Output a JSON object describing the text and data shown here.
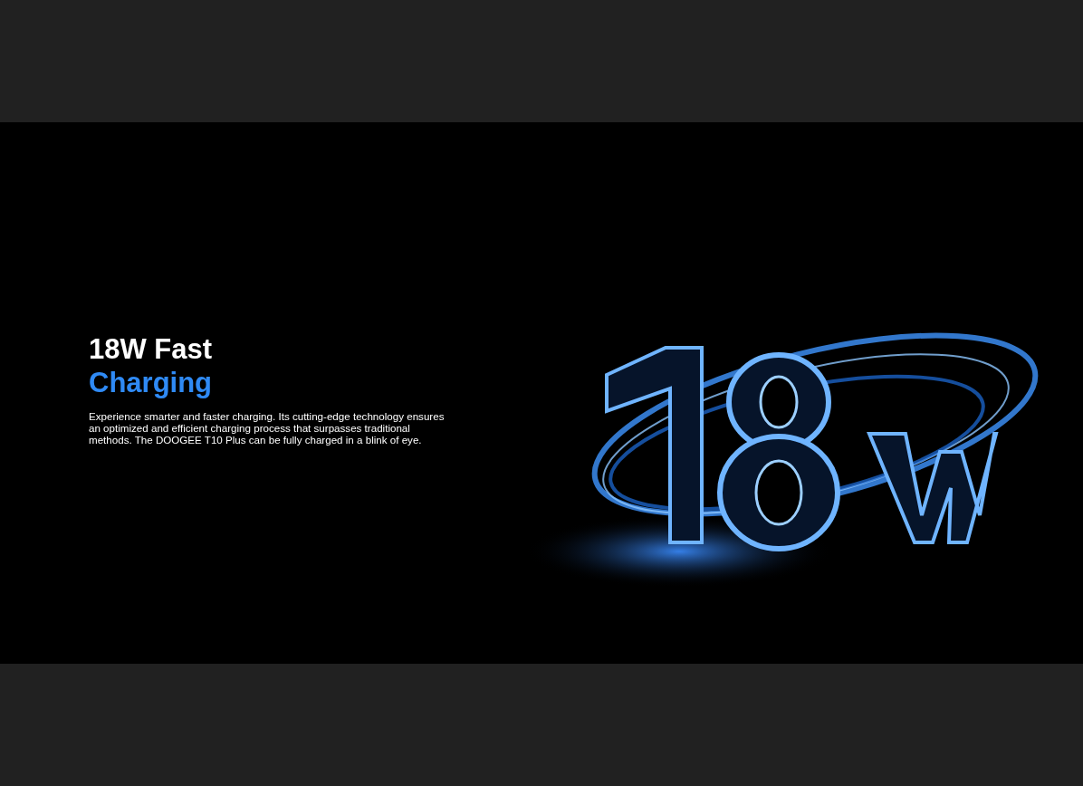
{
  "banner": {
    "heading": [
      {
        "text": "18W Fast",
        "accent": false
      },
      {
        "text": "Charging",
        "accent": true
      }
    ],
    "description": "Experience smarter and faster charging. Its cutting-edge technology ensures an optimized and efficient charging process that surpasses traditional methods. The DOOGEE T10 Plus can be fully charged in a blink of eye."
  }
}
